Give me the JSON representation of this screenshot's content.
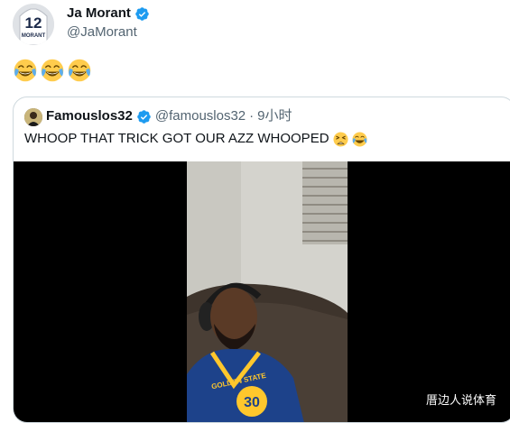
{
  "tweet": {
    "author_name": "Ja Morant",
    "author_handle": "@JaMorant",
    "avatar_jersey_number": "12",
    "avatar_jersey_name": "MORANT",
    "text_emojis": [
      "face-with-tears-of-joy",
      "face-with-tears-of-joy",
      "face-with-tears-of-joy"
    ]
  },
  "quote": {
    "author_name": "Famouslos32",
    "author_handle": "@famouslos32",
    "separator": "·",
    "time": "9小时",
    "text": "WHOOP THAT TRICK GOT OUR AZZ WHOOPED",
    "text_emojis": [
      "tired-face",
      "face-with-tears-of-joy"
    ],
    "media": {
      "jersey_text": "GOLDEN STATE",
      "jersey_number": "30",
      "watermark": "厝边人说体育"
    }
  },
  "colors": {
    "verified_blue": "#1d9bf0",
    "text_primary": "#0f1419",
    "text_secondary": "#536471",
    "border": "#cfd9de",
    "warriors_blue": "#1d428a",
    "warriors_gold": "#ffc72c"
  }
}
